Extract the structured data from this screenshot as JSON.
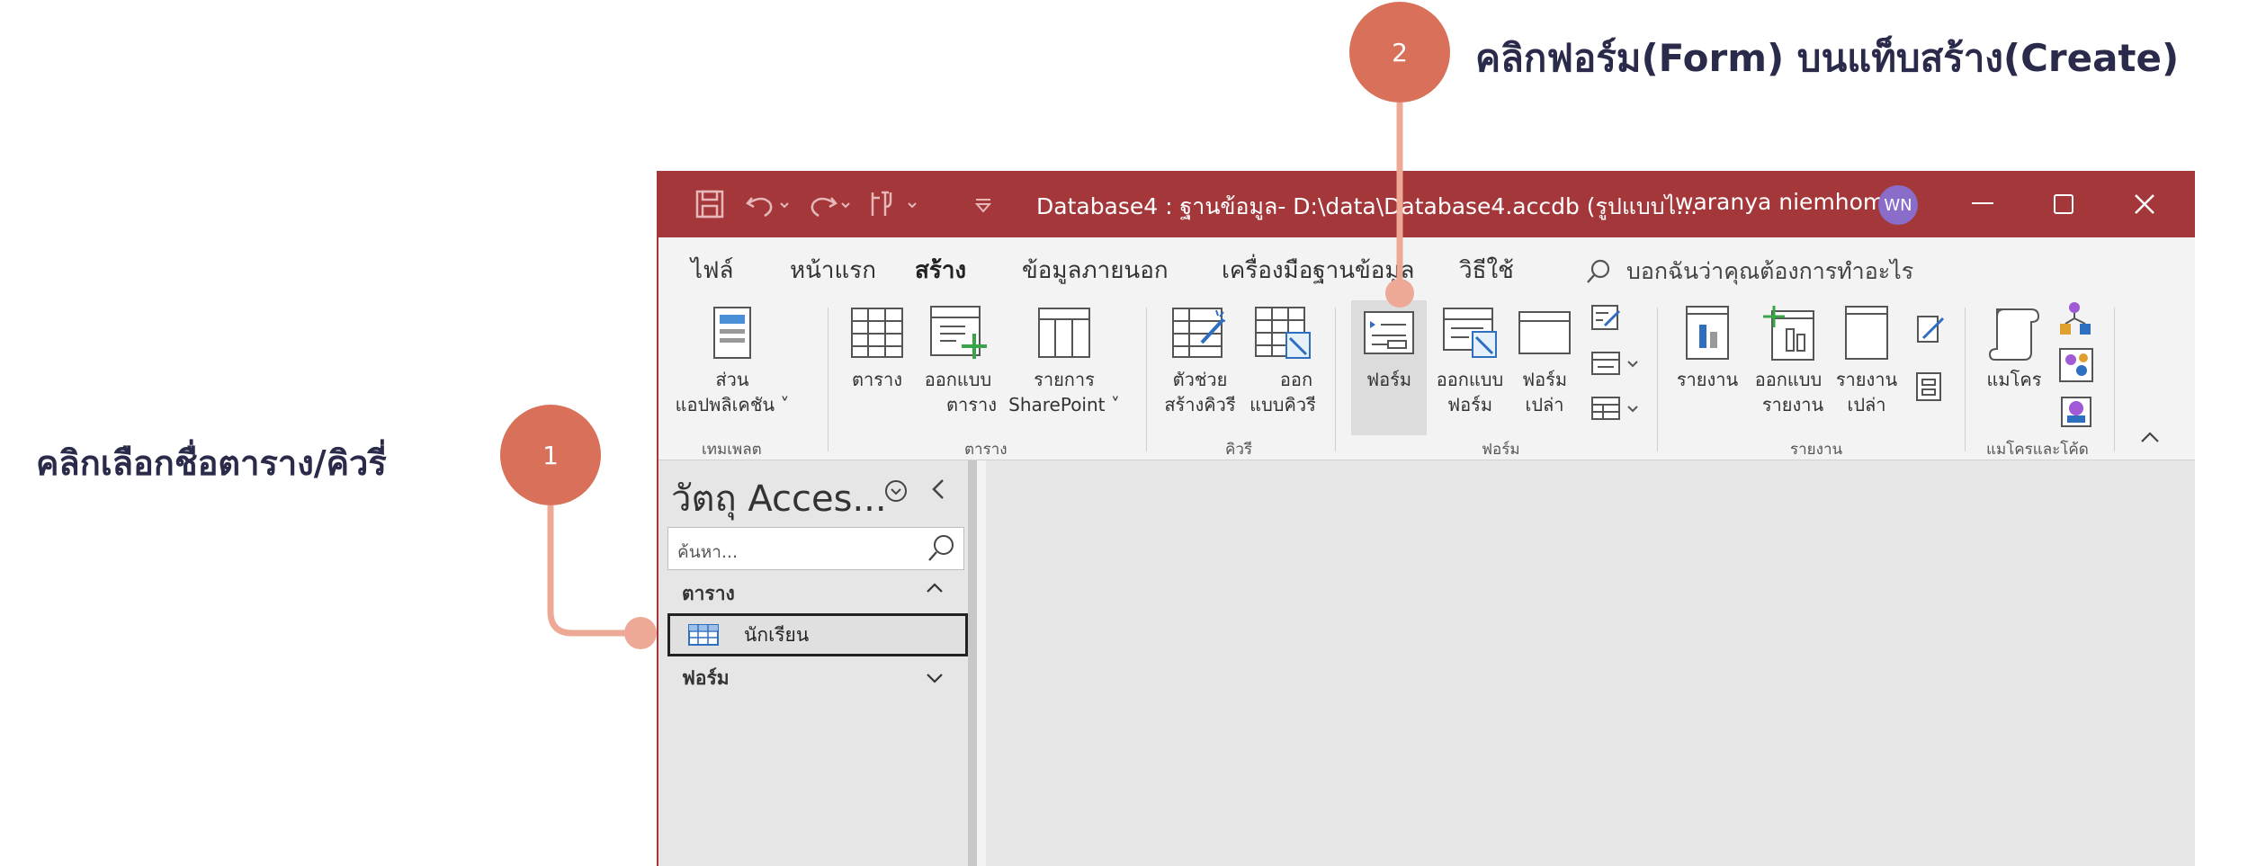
{
  "annotations": {
    "step1": {
      "number": "1",
      "text": "คลิกเลือกชื่อตาราง/คิวรี่"
    },
    "step2": {
      "number": "2",
      "text": "คลิกฟอร์ม(Form) บนแท็บสร้าง(Create)"
    }
  },
  "window": {
    "title": "Database4 : ฐานข้อมูล- D:\\data\\Database4.accdb (รูปแบบไ...",
    "user_name": "waranya niemhom",
    "user_initials": "WN"
  },
  "tabs": [
    {
      "label": "ไฟล์"
    },
    {
      "label": "หน้าแรก"
    },
    {
      "label": "สร้าง"
    },
    {
      "label": "ข้อมูลภายนอก"
    },
    {
      "label": "เครื่องมือฐานข้อมูล"
    },
    {
      "label": "วิธีใช้"
    }
  ],
  "tell_me": "บอกฉันว่าคุณต้องการทำอะไร",
  "ribbon": {
    "templates": {
      "label": "เทมเพลต",
      "app_parts_1": "ส่วน",
      "app_parts_2": "แอปพลิเคชัน ˅"
    },
    "tables": {
      "label": "ตาราง",
      "table": "ตาราง",
      "design_1": "ออกแบบ",
      "design_2": "ตาราง",
      "sp_1": "รายการ",
      "sp_2": "SharePoint ˅"
    },
    "queries": {
      "label": "คิวรี",
      "wizard_1": "ตัวช่วย",
      "wizard_2": "สร้างคิวรี",
      "design_1": "ออก",
      "design_2": "แบบคิวรี"
    },
    "forms": {
      "label": "ฟอร์ม",
      "form": "ฟอร์ม",
      "design_1": "ออกแบบ",
      "design_2": "ฟอร์ม",
      "blank_1": "ฟอร์ม",
      "blank_2": "เปล่า"
    },
    "reports": {
      "label": "รายงาน",
      "report": "รายงาน",
      "design_1": "ออกแบบ",
      "design_2": "รายงาน",
      "blank_1": "รายงาน",
      "blank_2": "เปล่า"
    },
    "macros": {
      "label": "แมโครและโค้ด",
      "macro": "แมโคร"
    }
  },
  "nav": {
    "title": "วัตถุ Acces...",
    "search_placeholder": "ค้นหา...",
    "section_tables": "ตาราง",
    "item_table": "นักเรียน",
    "section_forms": "ฟอร์ม"
  },
  "colors": {
    "accent": "#a4373a",
    "bubble": "#d9705a",
    "connector": "#eda995"
  }
}
